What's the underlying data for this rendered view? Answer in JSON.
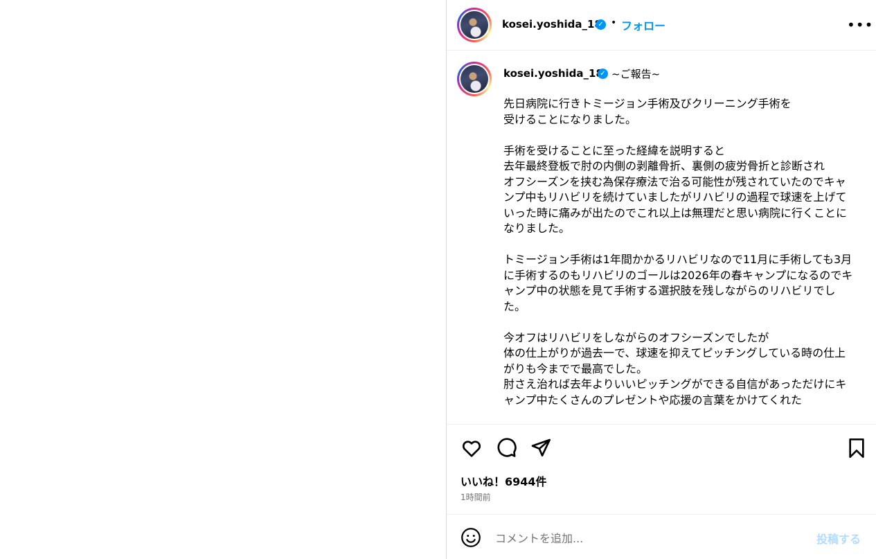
{
  "header": {
    "username": "kosei.yoshida_18",
    "separator": "•",
    "follow_label": "フォロー",
    "more_label": "•••"
  },
  "caption": {
    "username": "kosei.yoshida_18",
    "title": "~ご報告~",
    "lines": [
      "先日病院に行きトミージョン手術及びクリーニング手術を",
      "受けることになりました。",
      "",
      "手術を受けることに至った経緯を説明すると",
      "去年最終登板で肘の内側の剥離骨折、裏側の疲労骨折と診断され",
      "オフシーズンを挟む為保存療法で治る可能性が残されていたのでキャンプ中もリハビリを続けていましたがリハビリの過程で球速を上げていった時に痛みが出たのでこれ以上は無理だと思い病院に行くことになりました。",
      "",
      "トミージョン手術は1年間かかるリハビリなので11月に手術しても3月に手術するのもリハビリのゴールは2026年の春キャンプになるのでキャンプ中の状態を見て手術する選択肢を残しながらのリハビリでした。",
      "",
      "今オフはリハビリをしながらのオフシーズンでしたが",
      "体の仕上がりが過去一で、球速を抑えてピッチングしている時の仕上がりも今までで最高でした。",
      "肘さえ治れば去年よりいいピッチングができる自信があっただけにキャンプ中たくさんのプレゼントや応援の言葉をかけてくれた"
    ]
  },
  "actions": {
    "likes": "いいね！6944件",
    "time": "1時間前"
  },
  "comment": {
    "placeholder": "コメントを追加...",
    "post_label": "投稿する"
  },
  "colors": {
    "accent": "#0095f6",
    "verified": "#0095f6",
    "muted": "#737373",
    "post_disabled": "#b3dbff"
  },
  "icons": [
    "verified-icon",
    "more-icon",
    "heart-icon",
    "comment-icon",
    "share-icon",
    "bookmark-icon",
    "emoji-icon"
  ]
}
